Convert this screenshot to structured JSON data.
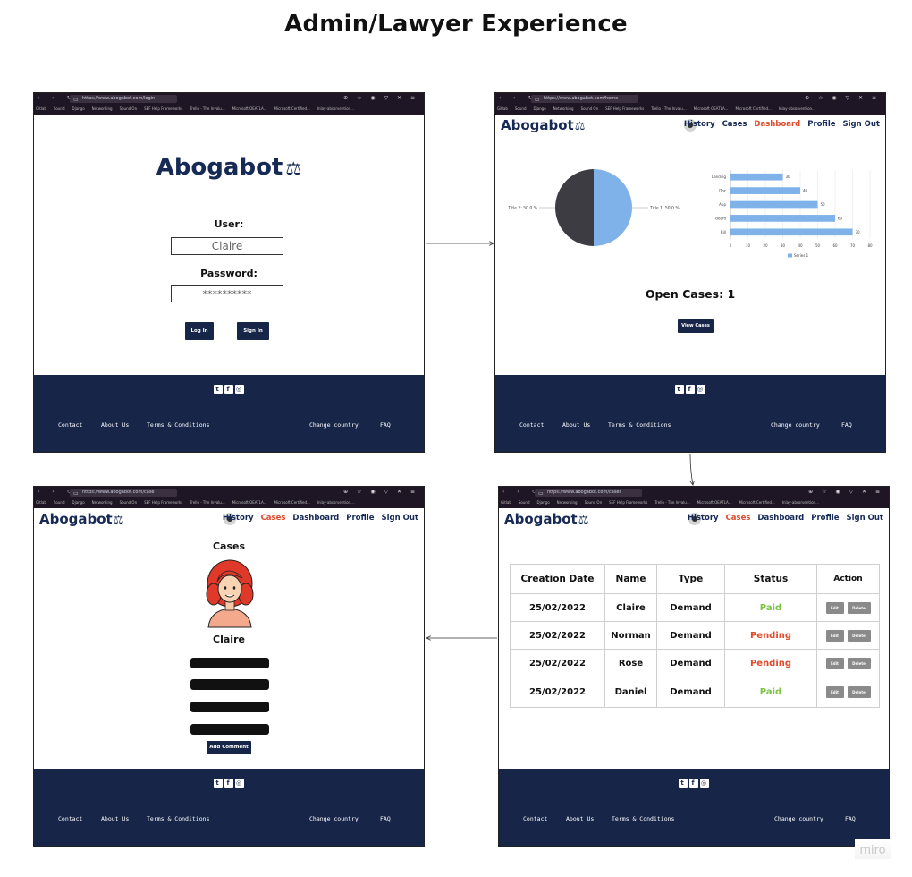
{
  "page": {
    "title": "Admin/Lawyer Experience",
    "watermark": "miro"
  },
  "logo": "Abogabot",
  "browser": {
    "bookmarks": [
      "Gitlab",
      "Sound",
      "Django",
      "Networking",
      "Sound On",
      "SEF Help Frameworks",
      "Trello - The Invalu...",
      "Microsoft OEATLA...",
      "Microsoft Certified...",
      "Inlay-absorvention..."
    ],
    "urls": {
      "login": "https://www.abogabot.com/login",
      "home": "https://www.abogabot.com/home",
      "case": "https://www.abogabot.com/case",
      "cases": "https://www.abogabot.com/cases"
    }
  },
  "nav": {
    "items": [
      "History",
      "Cases",
      "Dashboard",
      "Profile",
      "Sign Out"
    ]
  },
  "login": {
    "user_label": "User:",
    "user_value": "Claire",
    "password_label": "Password:",
    "password_value": "**********",
    "login_button": "Log In",
    "signin_button": "Sign In"
  },
  "footer": {
    "links": [
      "Contact",
      "About Us",
      "Terms & Conditions",
      "Change country",
      "FAQ"
    ],
    "social": [
      "twitter-icon",
      "facebook-icon",
      "instagram-icon"
    ]
  },
  "dashboard": {
    "open_cases": "Open Cases: 1",
    "view_cases_button": "View Cases"
  },
  "chart_data": [
    {
      "type": "pie",
      "labels": [
        "Title 1: 50.0 %",
        "Title 2: 50.0 %"
      ],
      "values": [
        50,
        50
      ],
      "colors": [
        "#7fb2e8",
        "#3c3c42"
      ]
    },
    {
      "type": "bar",
      "orientation": "horizontal",
      "categories": [
        "Landing",
        "Doc",
        "App",
        "Board",
        "Bill"
      ],
      "series": [
        {
          "name": "Series 1",
          "values": [
            30,
            40,
            50,
            60,
            70
          ]
        }
      ],
      "xlim": [
        0,
        80
      ],
      "xticks": [
        "0",
        "10",
        "20",
        "30",
        "40",
        "50",
        "60",
        "70",
        "80"
      ],
      "color": "#7fb2e8",
      "grid": true,
      "legend": "bottom"
    }
  ],
  "case_detail": {
    "heading": "Cases",
    "client_name": "Claire",
    "add_comment_button": "Add Comment"
  },
  "cases_table": {
    "headers": [
      "Creation Date",
      "Name",
      "Type",
      "Status",
      "Action"
    ],
    "rows": [
      {
        "date": "25/02/2022",
        "name": "Claire",
        "type": "Demand",
        "status": "Paid"
      },
      {
        "date": "25/02/2022",
        "name": "Norman",
        "type": "Demand",
        "status": "Pending"
      },
      {
        "date": "25/02/2022",
        "name": "Rose",
        "type": "Demand",
        "status": "Pending"
      },
      {
        "date": "25/02/2022",
        "name": "Daniel",
        "type": "Demand",
        "status": "Paid"
      }
    ],
    "edit_label": "Edit",
    "delete_label": "Delete"
  },
  "colors": {
    "navy": "#162548",
    "accent": "#e14a2a",
    "paid": "#7ac142",
    "bar": "#7fb2e8"
  }
}
